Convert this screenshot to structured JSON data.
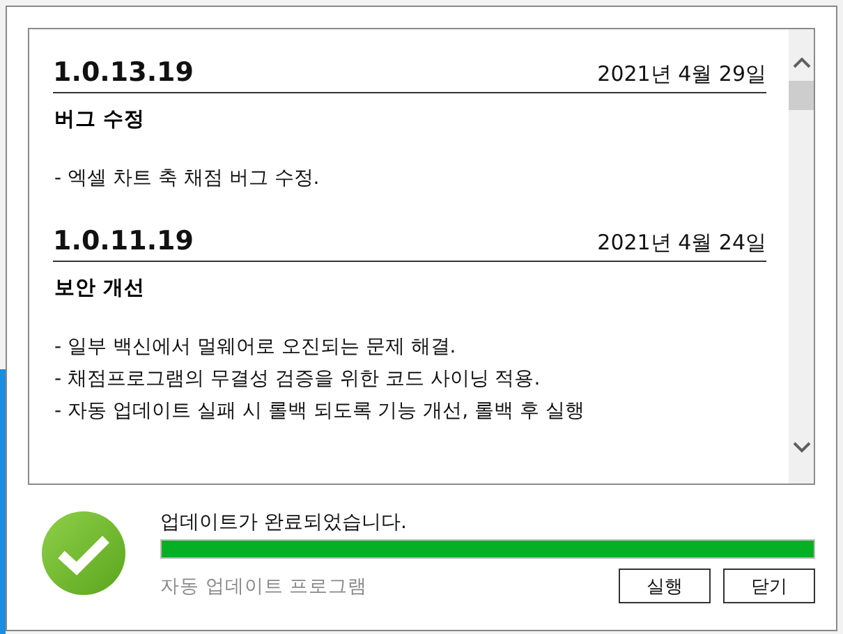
{
  "release_notes": [
    {
      "version": "1.0.13.19",
      "date": "2021년 4월 29일",
      "section": "버그 수정",
      "items": [
        "- 엑셀 차트 축 채점 버그 수정."
      ]
    },
    {
      "version": "1.0.11.19",
      "date": "2021년 4월 24일",
      "section": "보안 개선",
      "items": [
        "- 일부 백신에서 멀웨어로 오진되는 문제 해결.",
        "- 채점프로그램의 무결성 검증을 위한 코드 사이닝 적용.",
        "- 자동 업데이트 실패 시 롤백 되도록 기능 개선, 롤백 후 실행"
      ]
    }
  ],
  "status": {
    "message": "업데이트가 완료되었습니다.",
    "level": 1,
    "program_name": "자동 업데이트 프로그램"
  },
  "buttons": [
    "실행",
    "닫기"
  ]
}
